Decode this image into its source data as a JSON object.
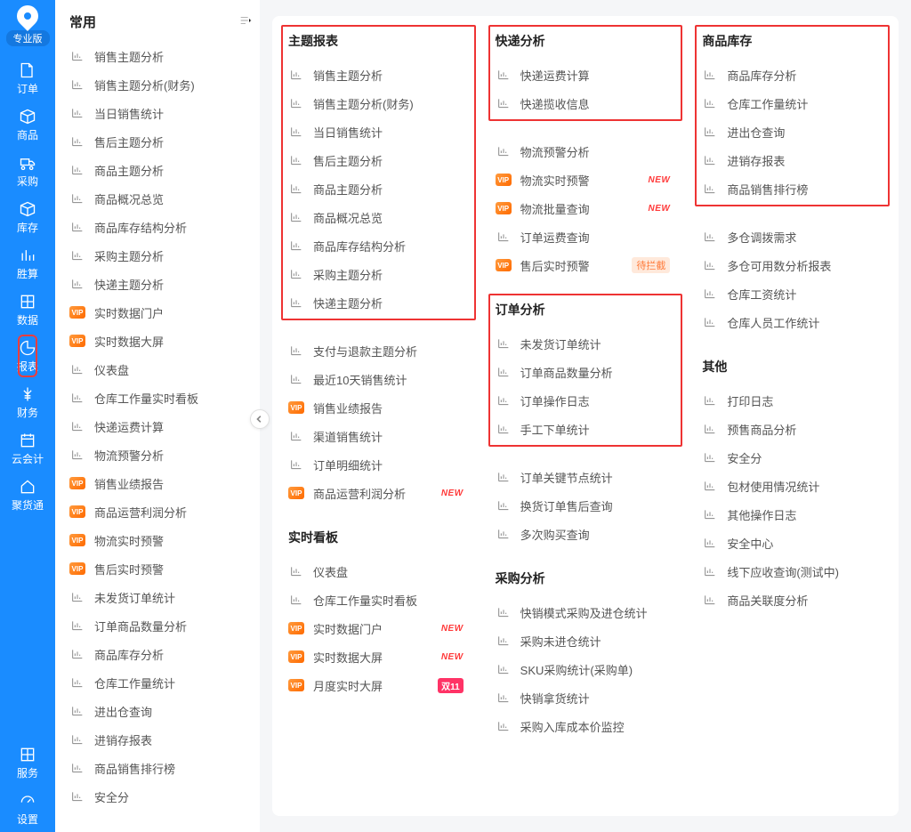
{
  "edition": "专业版",
  "leftnav": [
    {
      "label": "订单"
    },
    {
      "label": "商品"
    },
    {
      "label": "采购"
    },
    {
      "label": "库存"
    },
    {
      "label": "胜算"
    },
    {
      "label": "数据"
    },
    {
      "label": "报表"
    },
    {
      "label": "财务"
    },
    {
      "label": "云会计"
    },
    {
      "label": "聚货通"
    }
  ],
  "leftnav_bottom": [
    {
      "label": "服务"
    },
    {
      "label": "设置"
    }
  ],
  "panel": {
    "title": "常用",
    "items": [
      {
        "label": "销售主题分析"
      },
      {
        "label": "销售主题分析(财务)"
      },
      {
        "label": "当日销售统计"
      },
      {
        "label": "售后主题分析"
      },
      {
        "label": "商品主题分析"
      },
      {
        "label": "商品概况总览"
      },
      {
        "label": "商品库存结构分析"
      },
      {
        "label": "采购主题分析"
      },
      {
        "label": "快递主题分析"
      },
      {
        "label": "实时数据门户",
        "vip": true
      },
      {
        "label": "实时数据大屏",
        "vip": true
      },
      {
        "label": "仪表盘"
      },
      {
        "label": "仓库工作量实时看板"
      },
      {
        "label": "快递运费计算"
      },
      {
        "label": "物流预警分析"
      },
      {
        "label": "销售业绩报告",
        "vip": true
      },
      {
        "label": "商品运营利润分析",
        "vip": true
      },
      {
        "label": "物流实时预警",
        "vip": true
      },
      {
        "label": "售后实时预警",
        "vip": true
      },
      {
        "label": "未发货订单统计"
      },
      {
        "label": "订单商品数量分析"
      },
      {
        "label": "商品库存分析"
      },
      {
        "label": "仓库工作量统计"
      },
      {
        "label": "进出仓查询"
      },
      {
        "label": "进销存报表"
      },
      {
        "label": "商品销售排行榜"
      },
      {
        "label": "安全分"
      }
    ]
  },
  "maincols": [
    {
      "groups": [
        {
          "title": "主题报表",
          "boxed": true,
          "items": [
            {
              "label": "销售主题分析"
            },
            {
              "label": "销售主题分析(财务)"
            },
            {
              "label": "当日销售统计"
            },
            {
              "label": "售后主题分析"
            },
            {
              "label": "商品主题分析"
            },
            {
              "label": "商品概况总览"
            },
            {
              "label": "商品库存结构分析"
            },
            {
              "label": "采购主题分析"
            },
            {
              "label": "快递主题分析"
            }
          ],
          "tail": [
            {
              "label": "支付与退款主题分析"
            },
            {
              "label": "最近10天销售统计"
            },
            {
              "label": "销售业绩报告",
              "vip": true
            },
            {
              "label": "渠道销售统计"
            },
            {
              "label": "订单明细统计"
            },
            {
              "label": "商品运营利润分析",
              "vip": true,
              "tag": "new"
            }
          ]
        },
        {
          "title": "实时看板",
          "items": [
            {
              "label": "仪表盘"
            },
            {
              "label": "仓库工作量实时看板"
            },
            {
              "label": "实时数据门户",
              "vip": true,
              "tag": "new"
            },
            {
              "label": "实时数据大屏",
              "vip": true,
              "tag": "new"
            },
            {
              "label": "月度实时大屏",
              "vip": true,
              "tag": "d11"
            }
          ]
        }
      ]
    },
    {
      "groups": [
        {
          "title": "快递分析",
          "boxed": true,
          "items": [
            {
              "label": "快递运费计算"
            },
            {
              "label": "快递揽收信息"
            }
          ],
          "tail": [
            {
              "label": "物流预警分析"
            },
            {
              "label": "物流实时预警",
              "vip": true,
              "tag": "new"
            },
            {
              "label": "物流批量查询",
              "vip": true,
              "tag": "new"
            },
            {
              "label": "订单运费查询"
            },
            {
              "label": "售后实时预警",
              "vip": true,
              "tag": "pending"
            }
          ]
        },
        {
          "title": "订单分析",
          "boxed": true,
          "items": [
            {
              "label": "未发货订单统计"
            },
            {
              "label": "订单商品数量分析"
            },
            {
              "label": "订单操作日志"
            },
            {
              "label": "手工下单统计"
            }
          ],
          "tail": [
            {
              "label": "订单关键节点统计"
            },
            {
              "label": "换货订单售后查询"
            },
            {
              "label": "多次购买查询"
            }
          ]
        },
        {
          "title": "采购分析",
          "items": [
            {
              "label": "快销模式采购及进仓统计"
            },
            {
              "label": "采购未进仓统计"
            },
            {
              "label": "SKU采购统计(采购单)"
            },
            {
              "label": "快销拿货统计"
            },
            {
              "label": "采购入库成本价监控"
            }
          ]
        }
      ]
    },
    {
      "groups": [
        {
          "title": "商品库存",
          "boxed": true,
          "items": [
            {
              "label": "商品库存分析"
            },
            {
              "label": "仓库工作量统计"
            },
            {
              "label": "进出仓查询"
            },
            {
              "label": "进销存报表"
            },
            {
              "label": "商品销售排行榜"
            }
          ],
          "tail": [
            {
              "label": "多仓调拨需求"
            },
            {
              "label": "多仓可用数分析报表"
            },
            {
              "label": "仓库工资统计"
            },
            {
              "label": "仓库人员工作统计"
            }
          ]
        },
        {
          "title": "其他",
          "items": [
            {
              "label": "打印日志"
            },
            {
              "label": "预售商品分析"
            },
            {
              "label": "安全分"
            },
            {
              "label": "包材使用情况统计"
            },
            {
              "label": "其他操作日志"
            },
            {
              "label": "安全中心"
            },
            {
              "label": "线下应收查询(测试中)"
            },
            {
              "label": "商品关联度分析"
            }
          ]
        }
      ]
    }
  ],
  "tags": {
    "new": "NEW",
    "pending": "待拦截",
    "d11": "双11"
  }
}
